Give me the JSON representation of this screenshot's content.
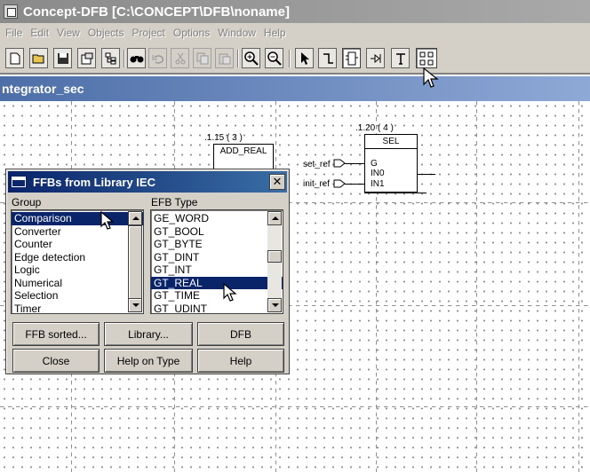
{
  "window": {
    "title": "Concept-DFB [C:\\CONCEPT\\DFB\\noname]"
  },
  "menu": [
    "File",
    "Edit",
    "View",
    "Objects",
    "Project",
    "Options",
    "Window",
    "Help"
  ],
  "document": {
    "title": "ntegrator_sec"
  },
  "toolbar_icons": [
    "new-icon",
    "open-icon",
    "save-icon",
    "properties-icon",
    "hierarchy-icon",
    "find-icon",
    "undo-icon",
    "cut-icon",
    "copy-icon",
    "paste-icon",
    "zoom-in-icon",
    "zoom-out-icon",
    "select-icon",
    "link-icon",
    "ffb-icon",
    "pin-icon",
    "text-icon",
    "ffb-library-icon"
  ],
  "blocks": {
    "add_real": {
      "label": ".1.15 ( 3 )",
      "name": "ADD_REAL"
    },
    "sel": {
      "label": ".1.20 ( 4 )",
      "name": "SEL",
      "pins": [
        "G",
        "IN0",
        "IN1"
      ]
    },
    "inputs": [
      "set_ref",
      "init_ref"
    ]
  },
  "dialog": {
    "title": "FFBs from Library IEC",
    "group_label": "Group",
    "type_label": "EFB Type",
    "groups": [
      "Comparison",
      "Converter",
      "Counter",
      "Edge detection",
      "Logic",
      "Numerical",
      "Selection",
      "Timer"
    ],
    "selected_group": "Comparison",
    "types": [
      "GE_WORD",
      "GT_BOOL",
      "GT_BYTE",
      "GT_DINT",
      "GT_INT",
      "GT_REAL",
      "GT_TIME",
      "GT_UDINT"
    ],
    "selected_type": "GT_REAL",
    "buttons": {
      "ffb_sorted": "FFB sorted...",
      "library": "Library...",
      "dfb": "DFB",
      "close": "Close",
      "help_on_type": "Help on Type",
      "help": "Help"
    }
  },
  "colors": {
    "dialog_title": "#0a246a",
    "doc_title": "#4d6ea8",
    "selection": "#0a246a"
  }
}
